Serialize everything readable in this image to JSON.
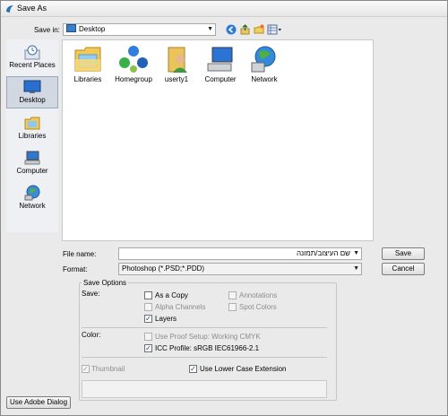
{
  "window": {
    "title": "Save As"
  },
  "save_in": {
    "label": "Save in:",
    "value": "Desktop"
  },
  "toolbar": {
    "back_icon": "back-arrow-icon",
    "up_icon": "up-folder-icon",
    "new_folder_icon": "new-folder-icon",
    "views_icon": "views-menu-icon"
  },
  "places": [
    {
      "label": "Recent Places",
      "icon": "recent-places-icon"
    },
    {
      "label": "Desktop",
      "icon": "desktop-icon",
      "selected": true
    },
    {
      "label": "Libraries",
      "icon": "libraries-icon"
    },
    {
      "label": "Computer",
      "icon": "computer-icon"
    },
    {
      "label": "Network",
      "icon": "network-icon"
    }
  ],
  "files": [
    {
      "label": "Libraries",
      "icon": "libraries-folder-icon"
    },
    {
      "label": "Homegroup",
      "icon": "homegroup-icon"
    },
    {
      "label": "userty1",
      "icon": "user-folder-icon"
    },
    {
      "label": "Computer",
      "icon": "computer-icon"
    },
    {
      "label": "Network",
      "icon": "network-icon"
    }
  ],
  "file_name": {
    "label": "File name:",
    "value": "שם העיצוב/תמונה"
  },
  "format": {
    "label": "Format:",
    "value": "Photoshop (*.PSD;*.PDD)"
  },
  "buttons": {
    "save": "Save",
    "cancel": "Cancel",
    "adobe_dialog": "Use Adobe Dialog"
  },
  "save_options": {
    "title": "Save Options",
    "save_label": "Save:",
    "as_a_copy": {
      "label": "As a Copy",
      "checked": false,
      "enabled": true
    },
    "alpha_channels": {
      "label": "Alpha Channels",
      "checked": false,
      "enabled": false
    },
    "layers": {
      "label": "Layers",
      "checked": true,
      "enabled": true
    },
    "annotations": {
      "label": "Annotations",
      "checked": false,
      "enabled": false
    },
    "spot_colors": {
      "label": "Spot Colors",
      "checked": false,
      "enabled": false
    },
    "color_label": "Color:",
    "use_proof_setup": {
      "label": "Use Proof Setup:  Working CMYK",
      "checked": false,
      "enabled": false
    },
    "icc_profile": {
      "label": "ICC Profile:  sRGB IEC61966-2.1",
      "checked": true,
      "enabled": true
    },
    "thumbnail": {
      "label": "Thumbnail",
      "checked": true,
      "enabled": false
    },
    "lower_case_ext": {
      "label": "Use Lower Case Extension",
      "checked": true,
      "enabled": true
    }
  }
}
